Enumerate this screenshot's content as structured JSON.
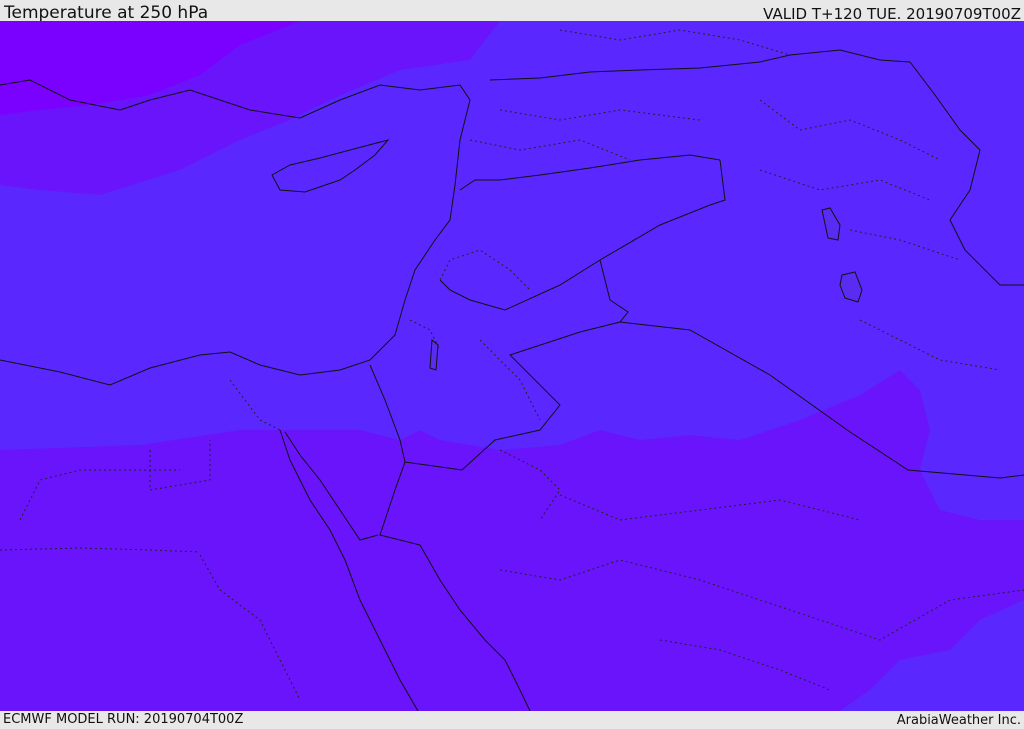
{
  "header": {
    "title": "Temperature at 250 hPa",
    "valid_time": "VALID T+120 TUE. 20190709T00Z"
  },
  "footer": {
    "model_run": "ECMWF MODEL RUN: 20190704T00Z",
    "credit": "ArabiaWeather Inc."
  },
  "map": {
    "colors": {
      "coldest": "#7a00ff",
      "cold": "#6a14fb",
      "cool": "#5a28ff",
      "mid": "#5530f6",
      "lake": "#5a2cf2"
    }
  }
}
